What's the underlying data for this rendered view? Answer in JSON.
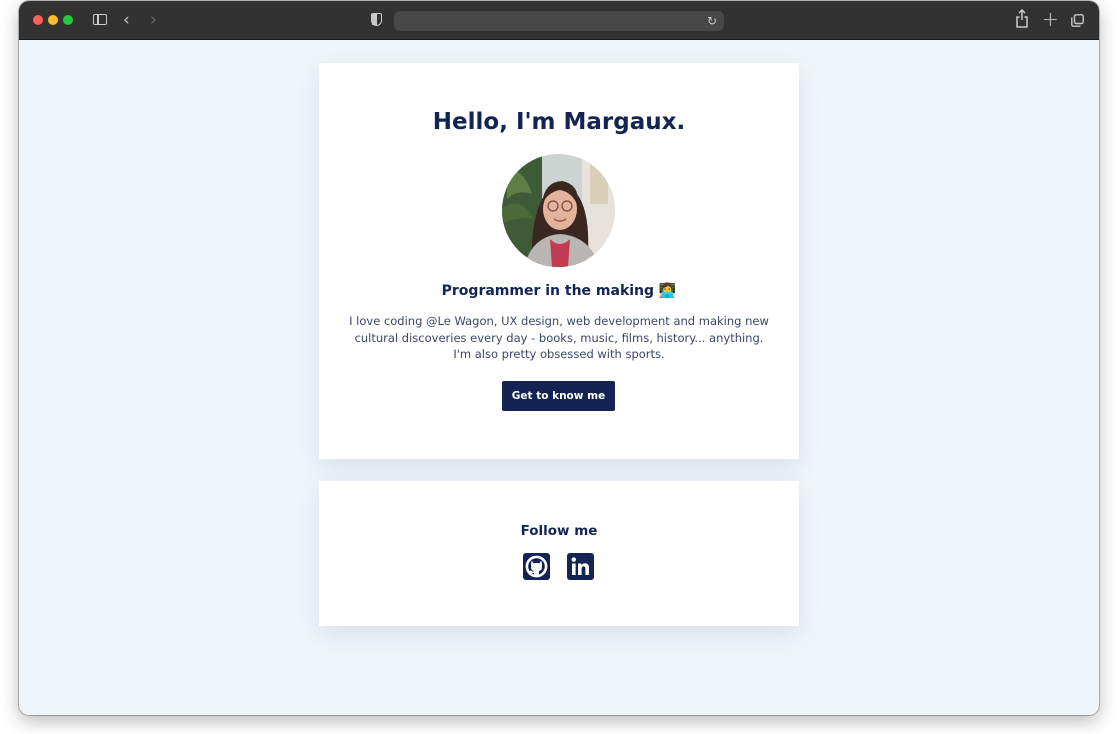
{
  "browser": {
    "address": ""
  },
  "hero": {
    "heading": "Hello, I'm Margaux.",
    "subtitle": "Programmer in the making 👩‍💻",
    "description": "I love coding @Le Wagon, UX design, web development and making new cultural discoveries every day - books, music, films, history... anything. I'm also pretty obsessed with sports.",
    "cta_label": "Get to know me"
  },
  "follow": {
    "title": "Follow me",
    "links": [
      "github-icon",
      "linkedin-icon"
    ]
  },
  "colors": {
    "navy": "#132353",
    "page_bg": "#f0f5fa",
    "card_bg": "#ffffff",
    "toolbar": "#323232"
  }
}
